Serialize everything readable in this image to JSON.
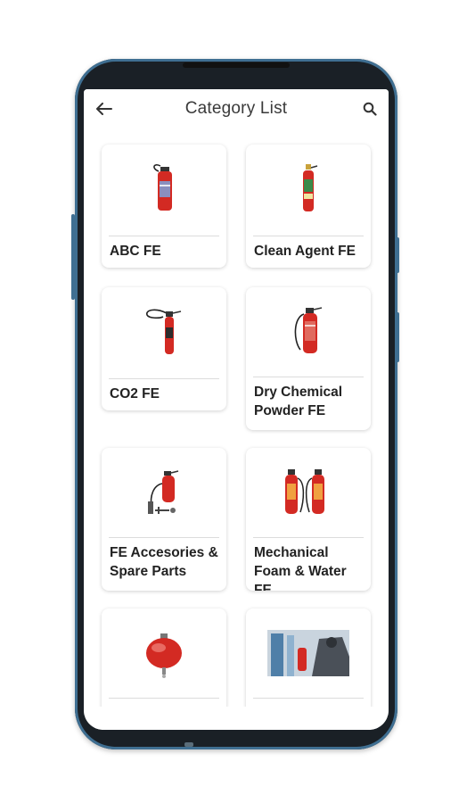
{
  "appbar": {
    "title": "Category List",
    "back_icon": "arrow-left-icon",
    "search_icon": "search-icon"
  },
  "colors": {
    "extinguisher_red": "#d32a23",
    "phone_accent": "#3f6f92",
    "text_primary": "#222222"
  },
  "categories": [
    {
      "label": "ABC FE",
      "image": "fire-extinguisher-abc"
    },
    {
      "label": "Clean Agent FE",
      "image": "fire-extinguisher-clean-agent"
    },
    {
      "label": "CO2 FE",
      "image": "fire-extinguisher-co2"
    },
    {
      "label": "Dry Chemical Powder FE",
      "image": "fire-extinguisher-dcp"
    },
    {
      "label": "FE Accesories & Spare Parts",
      "image": "fire-extinguisher-accessories"
    },
    {
      "label": "Mechanical Foam & Water FE",
      "image": "fire-extinguisher-foam-water"
    },
    {
      "label": "",
      "image": "modular-ceiling-extinguisher"
    },
    {
      "label": "",
      "image": "extinguisher-service-photo"
    }
  ]
}
